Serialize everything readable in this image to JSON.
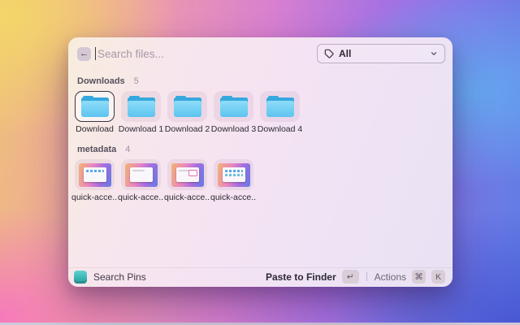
{
  "window": {
    "header": {
      "back_icon": "←",
      "search": {
        "placeholder": "Search files...",
        "value": ""
      },
      "filter": {
        "selected": "All"
      }
    },
    "sections": [
      {
        "title": "Downloads",
        "count": "5",
        "selected_index": 0,
        "items": [
          {
            "label": "Download"
          },
          {
            "label": "Download 1"
          },
          {
            "label": "Download 2"
          },
          {
            "label": "Download 3"
          },
          {
            "label": "Download 4"
          }
        ]
      },
      {
        "title": "metadata",
        "count": "4",
        "items": [
          {
            "label": "quick-acce..."
          },
          {
            "label": "quick-acce..."
          },
          {
            "label": "quick-acce..."
          },
          {
            "label": "quick-acce..."
          }
        ]
      }
    ],
    "footer": {
      "app_name": "Search Pins",
      "primary_action": "Paste to Finder",
      "primary_key": "↵",
      "actions_label": "Actions",
      "action_keys": [
        "⌘",
        "K"
      ]
    },
    "colors": {
      "folder_blue": "#4fc0ef",
      "app_icon_teal": "#3fbdba",
      "selection_border": "#3a3540",
      "window_bg": "#f3e4f1"
    }
  }
}
